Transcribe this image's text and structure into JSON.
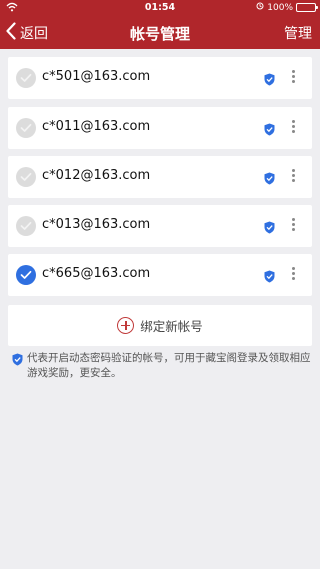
{
  "status": {
    "time": "01:54",
    "battery": "100%",
    "battery_level": 1.0
  },
  "nav": {
    "back_label": "返回",
    "title": "帐号管理",
    "manage_label": "管理"
  },
  "accounts": [
    {
      "email": "c*501@163.com",
      "selected": false
    },
    {
      "email": "c*011@163.com",
      "selected": false
    },
    {
      "email": "c*012@163.com",
      "selected": false
    },
    {
      "email": "c*013@163.com",
      "selected": false
    },
    {
      "email": "c*665@163.com",
      "selected": true
    }
  ],
  "bind": {
    "label": "绑定新帐号"
  },
  "note": {
    "text": "代表开启动态密码验证的帐号，可用于藏宝阁登录及领取相应游戏奖励，更安全。"
  },
  "colors": {
    "brand": "#b0262b",
    "selected": "#2f6fe0",
    "shield": "#2f6fe0"
  },
  "icons": {
    "back": "chevron-left-icon",
    "shield": "shield-check-icon",
    "more": "more-vertical-icon",
    "add": "plus-circle-icon",
    "wifi": "wifi-icon",
    "battery": "battery-icon",
    "check": "check-icon"
  }
}
